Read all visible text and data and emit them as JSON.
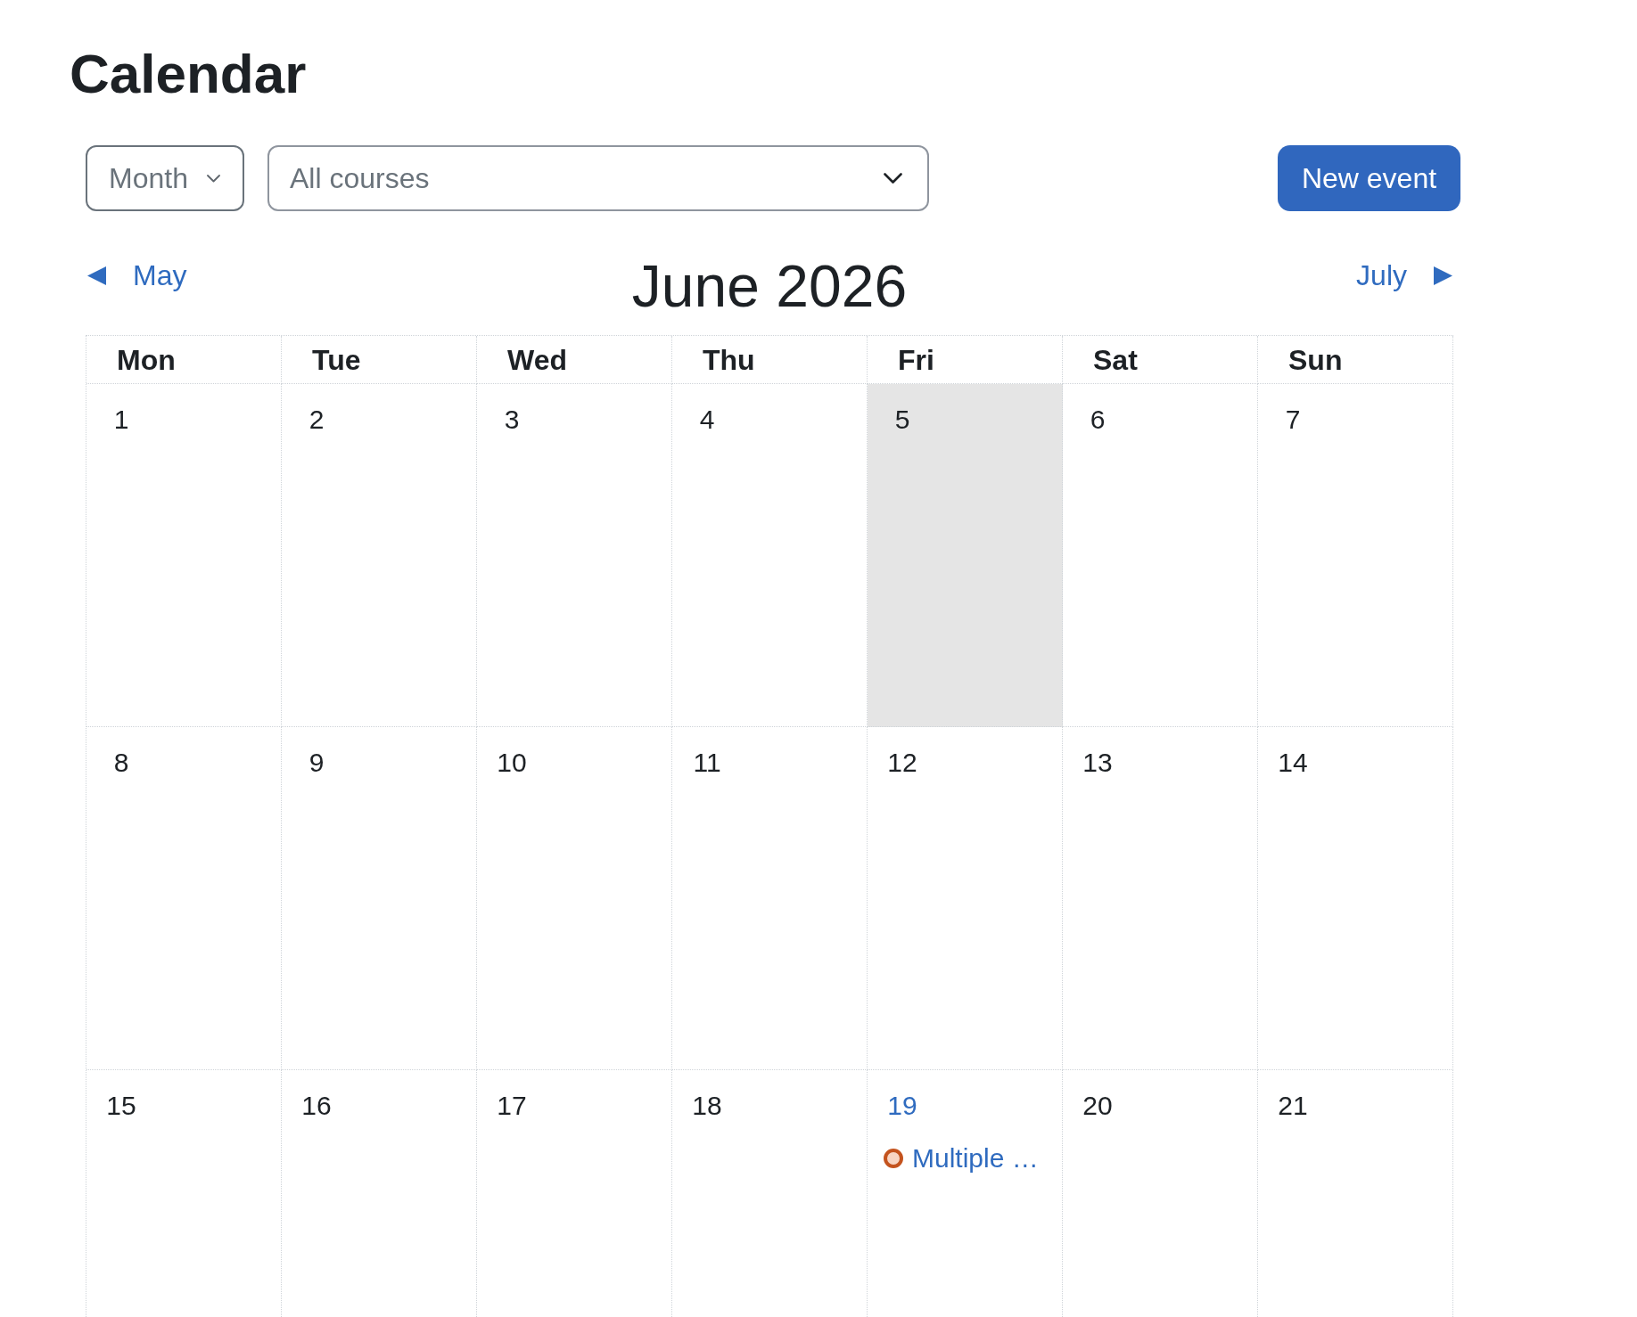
{
  "page_title": "Calendar",
  "toolbar": {
    "view_select": {
      "value": "Month"
    },
    "course_select": {
      "value": "All courses"
    },
    "new_event_button": {
      "label": "New event"
    }
  },
  "month_nav": {
    "previous": {
      "label": "May"
    },
    "current": "June 2026",
    "next": {
      "label": "July"
    }
  },
  "calendar": {
    "weekdays": [
      "Mon",
      "Tue",
      "Wed",
      "Thu",
      "Fri",
      "Sat",
      "Sun"
    ],
    "weeks": [
      {
        "days": [
          {
            "day": "1",
            "selected": false,
            "linked": false
          },
          {
            "day": "2",
            "selected": false,
            "linked": false
          },
          {
            "day": "3",
            "selected": false,
            "linked": false
          },
          {
            "day": "4",
            "selected": false,
            "linked": false
          },
          {
            "day": "5",
            "selected": true,
            "linked": false
          },
          {
            "day": "6",
            "selected": false,
            "linked": false
          },
          {
            "day": "7",
            "selected": false,
            "linked": false
          }
        ]
      },
      {
        "days": [
          {
            "day": "8",
            "selected": false,
            "linked": false
          },
          {
            "day": "9",
            "selected": false,
            "linked": false
          },
          {
            "day": "10",
            "selected": false,
            "linked": false
          },
          {
            "day": "11",
            "selected": false,
            "linked": false
          },
          {
            "day": "12",
            "selected": false,
            "linked": false
          },
          {
            "day": "13",
            "selected": false,
            "linked": false
          },
          {
            "day": "14",
            "selected": false,
            "linked": false
          }
        ]
      },
      {
        "days": [
          {
            "day": "15",
            "selected": false,
            "linked": false
          },
          {
            "day": "16",
            "selected": false,
            "linked": false
          },
          {
            "day": "17",
            "selected": false,
            "linked": false
          },
          {
            "day": "18",
            "selected": false,
            "linked": false
          },
          {
            "day": "19",
            "selected": false,
            "linked": true,
            "events": [
              {
                "label": "Multiple …"
              }
            ]
          },
          {
            "day": "20",
            "selected": false,
            "linked": false
          },
          {
            "day": "21",
            "selected": false,
            "linked": false
          }
        ]
      }
    ]
  }
}
